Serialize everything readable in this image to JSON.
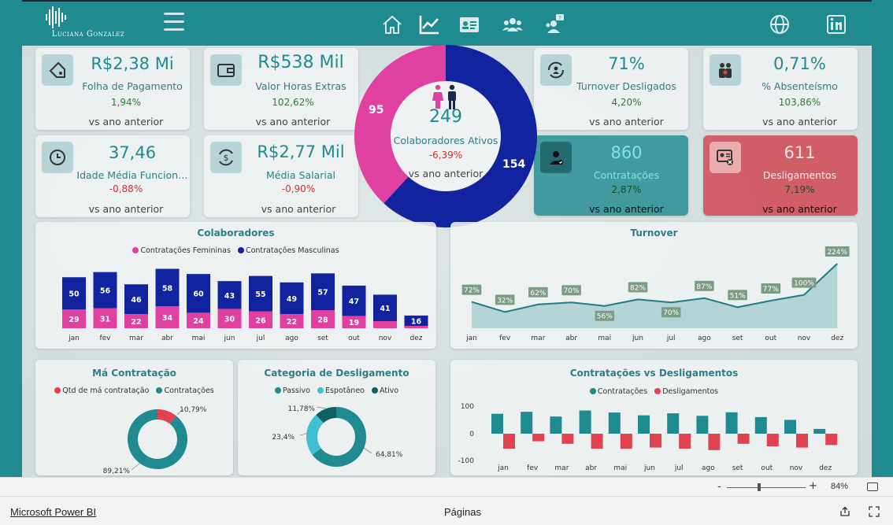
{
  "header": {
    "logo_text": "Luciana Gonzalez",
    "nav_icons": [
      "home-icon",
      "chart-line-icon",
      "id-card-icon",
      "team-icon",
      "help-people-icon"
    ],
    "right_icons": [
      "globe-icon",
      "linkedin-icon"
    ]
  },
  "colors": {
    "teal": "#1f8a8f",
    "navy": "#1223a0",
    "pink": "#e040a0",
    "red": "#e0424f",
    "cyan": "#3fbfcf",
    "darkteal": "#0f5f63",
    "olive": "#7d9c86"
  },
  "kpis": {
    "folha": {
      "value": "R$2,38 Mi",
      "label": "Folha de Pagamento",
      "pct": "1,94%",
      "vs": "vs ano anterior",
      "icon": "tag-icon"
    },
    "horas": {
      "value": "R$538 Mil",
      "label": "Valor Horas Extras",
      "pct": "102,62%",
      "vs": "vs ano anterior",
      "icon": "wallet-icon"
    },
    "idade": {
      "value": "37,46",
      "label": "Idade Média Funcion…",
      "pct": "-0,88%",
      "vs": "vs ano anterior",
      "icon": "clock-icon"
    },
    "salario": {
      "value": "R$2,77 Mil",
      "label": "Média Salarial",
      "pct": "-0,90%",
      "vs": "vs ano anterior",
      "icon": "dollar-cycle-icon"
    },
    "turnover": {
      "value": "71%",
      "label": "Turnover Desligados",
      "pct": "4,20%",
      "vs": "vs ano anterior",
      "icon": "cycle-people-icon"
    },
    "absenteismo": {
      "value": "0,71%",
      "label": "% Absenteísmo",
      "pct": "103,86%",
      "vs": "vs ano anterior",
      "icon": "people-group-icon"
    },
    "contratacoes": {
      "value": "860",
      "label": "Contratações",
      "pct": "2,87%",
      "vs": "vs ano anterior",
      "icon": "user-check-icon"
    },
    "desligamentos": {
      "value": "611",
      "label": "Desligamentos",
      "pct": "7,19%",
      "vs": "vs ano anterior",
      "icon": "user-remove-icon"
    }
  },
  "donut_main": {
    "value": "249",
    "label": "Colaboradores Ativos",
    "pct": "-6,39%",
    "vs": "vs ano anterior",
    "female": 95,
    "male": 154,
    "female_label": "95",
    "male_label": "154"
  },
  "chart_data": [
    {
      "type": "bar",
      "title": "Colaboradores",
      "stacked": true,
      "categories": [
        "jan",
        "fev",
        "mar",
        "abr",
        "mai",
        "jun",
        "jul",
        "ago",
        "set",
        "out",
        "nov",
        "dez"
      ],
      "series": [
        {
          "name": "Contratações Femininas",
          "values": [
            29,
            31,
            22,
            34,
            24,
            30,
            26,
            22,
            28,
            19,
            null,
            null
          ],
          "labels": [
            "29",
            "31",
            "22",
            "34",
            "24",
            "30",
            "26",
            "22",
            "28",
            "19",
            "",
            ""
          ],
          "color": "#e040a0"
        },
        {
          "name": "Contratações Masculinas",
          "values": [
            50,
            56,
            46,
            58,
            60,
            43,
            55,
            49,
            57,
            47,
            41,
            16
          ],
          "labels": [
            "50",
            "56",
            "46",
            "58",
            "60",
            "43",
            "55",
            "49",
            "57",
            "47",
            "41",
            "16"
          ],
          "color": "#1223a0"
        }
      ],
      "legend": "top-center"
    },
    {
      "type": "area",
      "title": "Turnover",
      "categories": [
        "jan",
        "fev",
        "mar",
        "abr",
        "mai",
        "jun",
        "jul",
        "ago",
        "set",
        "out",
        "nov",
        "dez"
      ],
      "values": [
        72,
        32,
        62,
        70,
        56,
        82,
        70,
        87,
        51,
        77,
        100,
        224
      ],
      "labels": [
        "72%",
        "32%",
        "62%",
        "70%",
        "56%",
        "82%",
        "70%",
        "87%",
        "51%",
        "77%",
        "100%",
        "224%"
      ],
      "ylim": [
        0,
        240
      ]
    },
    {
      "type": "pie",
      "title": "Má Contratação",
      "series": [
        {
          "name": "Qtd de má contratação",
          "value": 10.79,
          "label": "10,79%",
          "color": "#e0424f"
        },
        {
          "name": "Contratações",
          "value": 89.21,
          "label": "89,21%",
          "color": "#1f8a8f"
        }
      ]
    },
    {
      "type": "pie",
      "title": "Categoria de Desligamento",
      "series": [
        {
          "name": "Passivo",
          "value": 64.81,
          "label": "64,81%",
          "color": "#1f8a8f"
        },
        {
          "name": "Espotâneo",
          "value": 23.4,
          "label": "23,4%",
          "color": "#3fbfcf"
        },
        {
          "name": "Ativo",
          "value": 11.78,
          "label": "11,78%",
          "color": "#0f5f63"
        }
      ]
    },
    {
      "type": "bar",
      "title": "Contratações vs Desligamentos",
      "categories": [
        "jan",
        "fev",
        "mar",
        "abr",
        "mai",
        "jun",
        "jul",
        "ago",
        "set",
        "out",
        "nov",
        "dez"
      ],
      "series": [
        {
          "name": "Contratações",
          "values": [
            79,
            87,
            68,
            92,
            84,
            73,
            81,
            71,
            85,
            66,
            55,
            19
          ],
          "color": "#1f8a8f"
        },
        {
          "name": "Desligamentos",
          "values": [
            -60,
            -30,
            -40,
            -60,
            -60,
            -55,
            -60,
            -65,
            -40,
            -50,
            -55,
            -45
          ],
          "color": "#e0424f"
        }
      ],
      "yticks": [
        "100",
        "0",
        "-100"
      ],
      "ylim": [
        -100,
        100
      ]
    }
  ],
  "status": {
    "zoom_minus": "-",
    "zoom_plus": "+",
    "zoom": "84%",
    "zoom_level": 0.4,
    "app_link": "Microsoft Power BI",
    "pages": "Páginas"
  }
}
